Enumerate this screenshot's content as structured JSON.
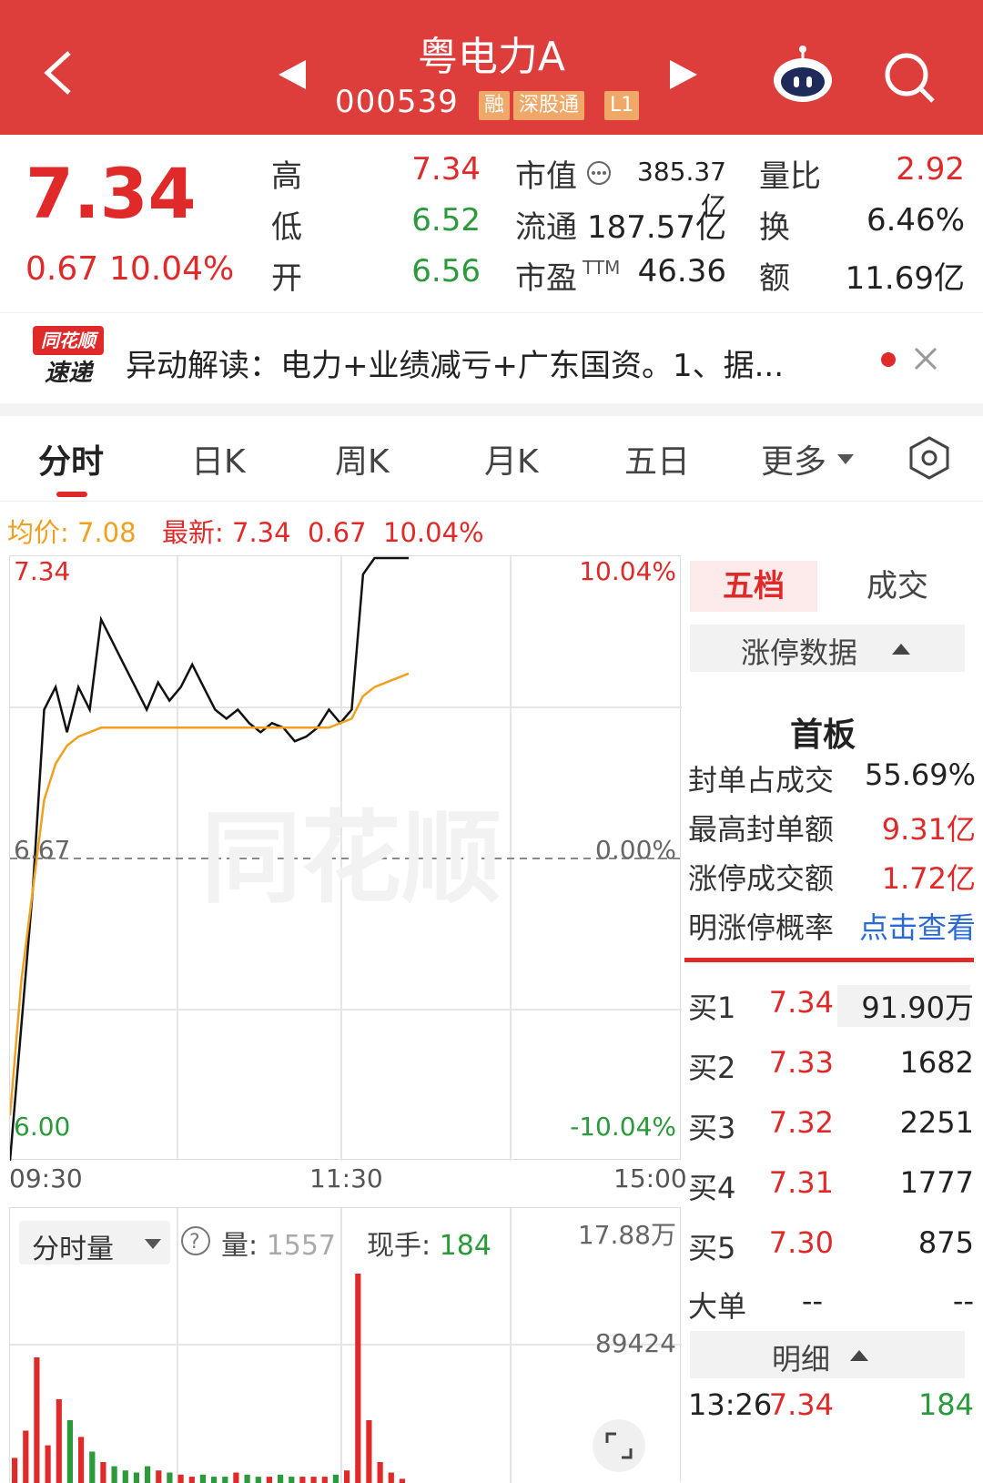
{
  "header": {
    "title": "粤电力A",
    "code": "000539",
    "tags": [
      "融",
      "深股通",
      "L1"
    ]
  },
  "quote": {
    "price": "7.34",
    "change": "0.67",
    "change_pct": "10.04%",
    "high_label": "高",
    "high": "7.34",
    "low_label": "低",
    "low": "6.52",
    "open_label": "开",
    "open": "6.56",
    "mcap_label": "市值",
    "mcap": "385.37亿",
    "float_label": "流通",
    "float": "187.57亿",
    "pe_label": "市盈",
    "pe_sup": "TTM",
    "pe": "46.36",
    "vr_label": "量比",
    "vr": "2.92",
    "turnover_label": "换",
    "turnover": "6.46%",
    "amount_label": "额",
    "amount": "11.69亿"
  },
  "news": {
    "logo_top": "同花顺",
    "logo_bottom": "速递",
    "text": "异动解读：电力+业绩减亏+广东国资。1、据..."
  },
  "tabs": [
    "分时",
    "日K",
    "周K",
    "月K",
    "五日",
    "更多"
  ],
  "chart": {
    "avg_label": "均价:",
    "avg": "7.08",
    "latest_label": "最新:",
    "latest": "7.34",
    "latest_chg": "0.67",
    "latest_pct": "10.04%",
    "y_top": "7.34",
    "y_mid": "6.67",
    "y_bot": "6.00",
    "pct_top": "10.04%",
    "pct_mid": "0.00%",
    "pct_bot": "-10.04%",
    "t_start": "09:30",
    "t_mid": "11:30",
    "t_end": "15:00",
    "watermark": "同花顺",
    "vol_selector": "分时量",
    "vol_label": "量:",
    "vol_value": "1557",
    "hand_label": "现手:",
    "hand_value": "184",
    "vol_top": "17.88万",
    "vol_mid": "89424"
  },
  "chart_data": {
    "type": "line",
    "series": [
      {
        "name": "最新",
        "values": [
          6.0,
          6.3,
          6.6,
          7.0,
          7.05,
          6.95,
          7.05,
          7.0,
          7.2,
          7.15,
          7.1,
          7.05,
          7.0,
          7.06,
          7.02,
          7.05,
          7.1,
          7.05,
          7.0,
          6.98,
          7.0,
          6.97,
          6.95,
          6.97,
          6.96,
          6.93,
          6.94,
          6.96,
          7.0,
          6.97,
          7.0,
          7.3,
          7.34,
          7.34,
          7.34,
          7.34
        ]
      },
      {
        "name": "均价",
        "values": [
          6.1,
          6.4,
          6.6,
          6.8,
          6.88,
          6.92,
          6.94,
          6.95,
          6.96,
          6.96,
          6.96,
          6.96,
          6.96,
          6.96,
          6.96,
          6.96,
          6.96,
          6.96,
          6.96,
          6.96,
          6.96,
          6.96,
          6.96,
          6.96,
          6.96,
          6.96,
          6.96,
          6.96,
          6.96,
          6.97,
          6.98,
          7.03,
          7.05,
          7.06,
          7.07,
          7.08
        ]
      }
    ],
    "ylim": [
      6.0,
      7.34
    ],
    "volume": [
      12,
      25,
      60,
      18,
      40,
      30,
      22,
      15,
      10,
      8,
      6,
      5,
      8,
      6,
      5,
      4,
      3,
      4,
      3,
      3,
      5,
      4,
      3,
      3,
      4,
      3,
      3,
      3,
      3,
      4,
      6,
      100,
      30,
      10,
      5,
      2
    ]
  },
  "panel": {
    "tab_five": "五档",
    "tab_trades": "成交",
    "limit_data": "涨停数据",
    "board": "首板",
    "rows": [
      {
        "label": "封单占成交",
        "value": "55.69%"
      },
      {
        "label": "最高封单额",
        "value": "9.31亿"
      },
      {
        "label": "涨停成交额",
        "value": "1.72亿"
      },
      {
        "label": "明涨停概率",
        "value": "点击查看"
      }
    ],
    "bids": [
      {
        "label": "买1",
        "price": "7.34",
        "vol": "91.90万"
      },
      {
        "label": "买2",
        "price": "7.33",
        "vol": "1682"
      },
      {
        "label": "买3",
        "price": "7.32",
        "vol": "2251"
      },
      {
        "label": "买4",
        "price": "7.31",
        "vol": "1777"
      },
      {
        "label": "买5",
        "price": "7.30",
        "vol": "875"
      }
    ],
    "big_label": "大单",
    "big_price": "--",
    "big_vol": "--",
    "detail_label": "明细",
    "detail_time": "13:26",
    "detail_price": "7.34",
    "detail_vol": "184"
  },
  "colors": {
    "brand": "#de3e3b",
    "up": "#e02a2a",
    "down": "#2a9a3a",
    "avg": "#f0a020",
    "link": "#2a6ad8"
  }
}
